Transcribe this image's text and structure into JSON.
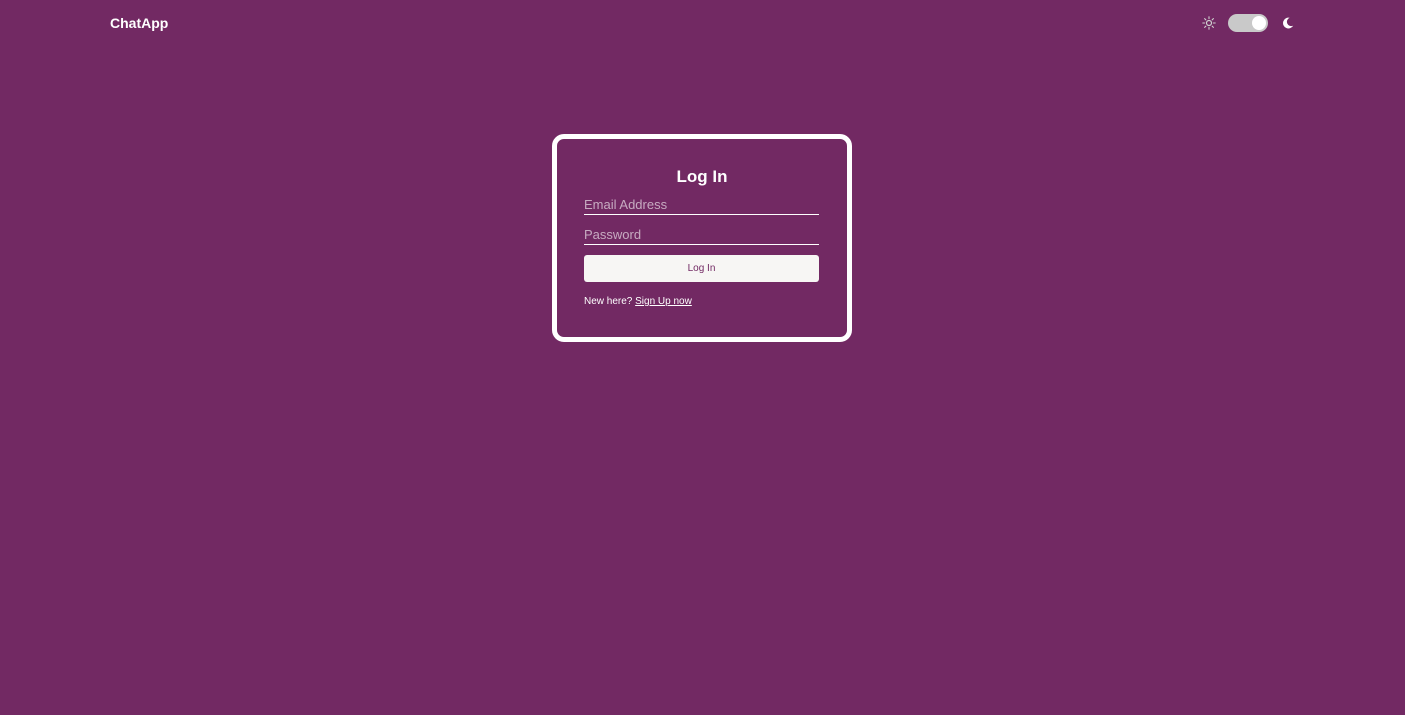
{
  "header": {
    "brand": "ChatApp",
    "theme_toggle": {
      "light_icon": "sun-icon",
      "dark_icon": "moon-icon",
      "enabled": true
    }
  },
  "login": {
    "title": "Log In",
    "email_placeholder": "Email Address",
    "password_placeholder": "Password",
    "submit_label": "Log In",
    "signup_prompt": "New here?",
    "signup_link": "Sign Up now"
  },
  "colors": {
    "background": "#722963",
    "text": "#ffffff",
    "button_background": "#f7f6f4",
    "button_text": "#722963",
    "toggle_track": "#c9c9c9"
  }
}
